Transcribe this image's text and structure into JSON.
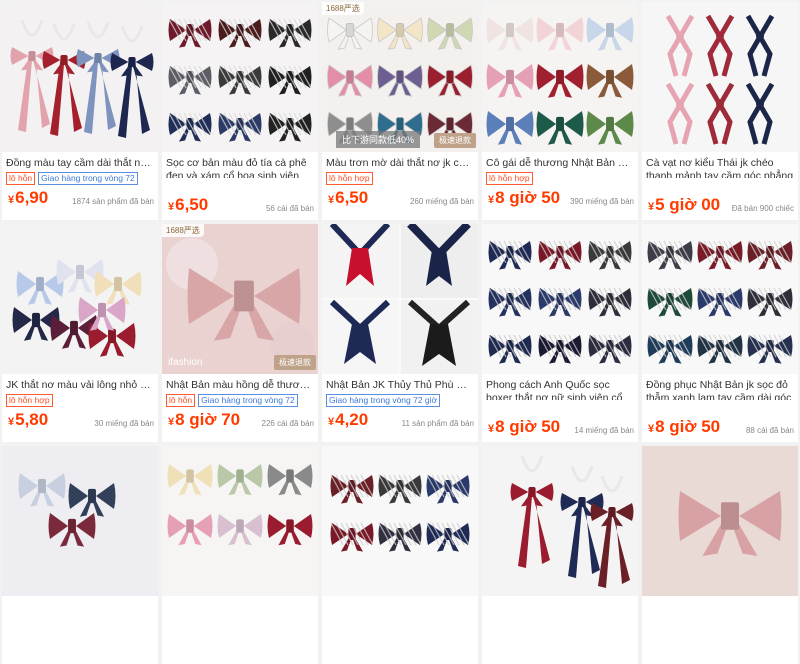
{
  "products": [
    {
      "title": "Đồng màu tay cầm dài thắt nơ ...",
      "tags": [
        {
          "label": "lô hỗn",
          "color": "orange"
        },
        {
          "label": "Giao hàng trong vòng 72",
          "color": "blue"
        }
      ],
      "price": "6,90",
      "sold": "1874 sản phẩm đã bán",
      "badge": "",
      "overlay": "",
      "fast": ""
    },
    {
      "title": "Sọc cơ bản màu đỏ tía cà phê đen và xám cổ hoa sinh viên đại h...",
      "tags": [],
      "price": "6,50",
      "sold": "56 cái đã bán",
      "badge": "",
      "overlay": "",
      "fast": ""
    },
    {
      "title": "Màu trơn mờ dài thắt nơ jk cổ ...",
      "tags": [
        {
          "label": "lô hỗn hợp",
          "color": "orange"
        }
      ],
      "price": "6,50",
      "sold": "260 miếng đã bán",
      "badge": "1688严选",
      "overlay": "比下游同款低40%",
      "fast": "极速退款"
    },
    {
      "title": "Cô gái dễ thương Nhật Bản mà...",
      "tags": [
        {
          "label": "lô hỗn hợp",
          "color": "orange"
        }
      ],
      "price": "8 giờ 50",
      "sold": "390 miếng đã bán",
      "badge": "",
      "overlay": "",
      "fast": ""
    },
    {
      "title": "Cà vạt nơ kiểu Thái jk chéo thanh mảnh tay cầm góc phẳng với g...",
      "tags": [],
      "price": "5 giờ 00",
      "sold": "Đã bán 900 chiếc",
      "badge": "",
      "overlay": "",
      "fast": ""
    },
    {
      "title": "JK thắt nơ màu vải lông nhỏ m...",
      "tags": [
        {
          "label": "lô hỗn hợp",
          "color": "orange"
        }
      ],
      "price": "5,80",
      "sold": "30 miếng đã bán",
      "badge": "",
      "overlay": "",
      "fast": ""
    },
    {
      "title": "Nhật Bản màu hồng dễ thương...",
      "tags": [
        {
          "label": "lô hỗn",
          "color": "orange"
        },
        {
          "label": "Giao hàng trong vòng 72",
          "color": "blue"
        }
      ],
      "price": "8 giờ 70",
      "sold": "226 cái đã bán",
      "badge": "1688严选",
      "overlay": "ifashion",
      "fast": "极速退款"
    },
    {
      "title": "Nhật Bản JK Thủy Thủ Phù Hợp...",
      "tags": [
        {
          "label": "Giao hàng trong vòng 72 giờ",
          "color": "blue"
        }
      ],
      "price": "4,20",
      "sold": "11 sản phẩm đã bán",
      "badge": "",
      "overlay": "",
      "fast": ""
    },
    {
      "title": "Phong cách Anh Quốc sọc boxer thắt nơ nữ sinh viên cổ áo hoa ...",
      "tags": [],
      "price": "8 giờ 50",
      "sold": "14 miếng đã bán",
      "badge": "",
      "overlay": "",
      "fast": ""
    },
    {
      "title": "Đồng phục Nhật Bản jk sọc đỏ thẫm xanh lam tay cầm dài góc ...",
      "tags": [],
      "price": "8 giờ 50",
      "sold": "88 cái đã bán",
      "badge": "",
      "overlay": "",
      "fast": ""
    },
    {
      "title": "",
      "tags": [],
      "price": "",
      "sold": "",
      "badge": "",
      "overlay": "",
      "fast": ""
    },
    {
      "title": "",
      "tags": [],
      "price": "",
      "sold": "",
      "badge": "",
      "overlay": "",
      "fast": ""
    },
    {
      "title": "",
      "tags": [],
      "price": "",
      "sold": "",
      "badge": "",
      "overlay": "",
      "fast": ""
    },
    {
      "title": "",
      "tags": [],
      "price": "",
      "sold": "",
      "badge": "",
      "overlay": "",
      "fast": ""
    },
    {
      "title": "",
      "tags": [],
      "price": "",
      "sold": "",
      "badge": "",
      "overlay": "",
      "fast": ""
    }
  ],
  "currency_symbol": "¥",
  "colors": {
    "price": "#ff3b00",
    "tag_orange": "#ff4b1f",
    "tag_blue": "#3c78d8"
  }
}
